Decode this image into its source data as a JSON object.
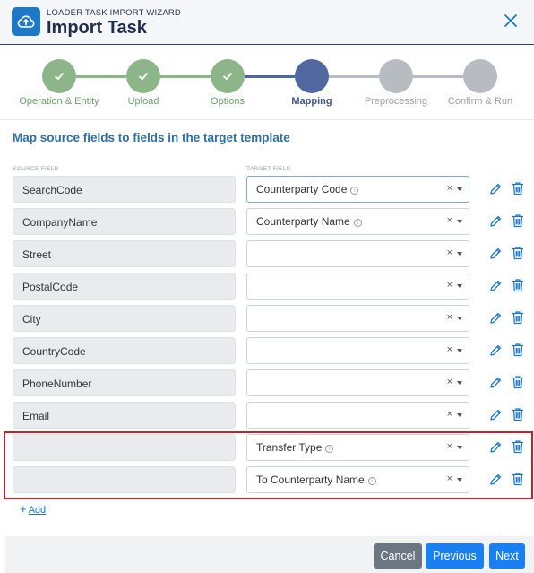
{
  "header": {
    "subtitle": "LOADER TASK IMPORT WIZARD",
    "title": "Import Task",
    "app_icon": "cloud-upload-icon",
    "close_icon": "close-icon"
  },
  "stepper": {
    "steps": [
      {
        "label": "Operation & Entity",
        "state": "done"
      },
      {
        "label": "Upload",
        "state": "done"
      },
      {
        "label": "Options",
        "state": "done"
      },
      {
        "label": "Mapping",
        "state": "current"
      },
      {
        "label": "Preprocessing",
        "state": "todo"
      },
      {
        "label": "Confirm & Run",
        "state": "todo"
      }
    ]
  },
  "section_title": "Map source fields to fields in the target template",
  "columns": {
    "source": "SOURCE FIELD",
    "target": "TARGET FIELD"
  },
  "mapping_rows": [
    {
      "source": "SearchCode",
      "target": "Counterparty Code",
      "info": true
    },
    {
      "source": "CompanyName",
      "target": "Counterparty Name",
      "info": true
    },
    {
      "source": "Street",
      "target": "",
      "info": false
    },
    {
      "source": "PostalCode",
      "target": "",
      "info": false
    },
    {
      "source": "City",
      "target": "",
      "info": false
    },
    {
      "source": "CountryCode",
      "target": "",
      "info": false
    },
    {
      "source": "PhoneNumber",
      "target": "",
      "info": false
    },
    {
      "source": "Email",
      "target": "",
      "info": false
    },
    {
      "source": "",
      "target": "Transfer Type",
      "info": true
    },
    {
      "source": "",
      "target": "To Counterparty Name",
      "info": true
    }
  ],
  "add_link": {
    "plus": "+",
    "label": "Add"
  },
  "footer": {
    "cancel": "Cancel",
    "previous": "Previous",
    "next": "Next"
  },
  "colors": {
    "header_title": "#1f2e4d",
    "step_done": "#8db58a",
    "step_current": "#51679f",
    "step_todo": "#b6bcc2",
    "section_title": "#2f6ea3",
    "primary_button": "#1a7ff0",
    "cancel_button": "#6c7582",
    "highlight_border": "#cc2027"
  }
}
